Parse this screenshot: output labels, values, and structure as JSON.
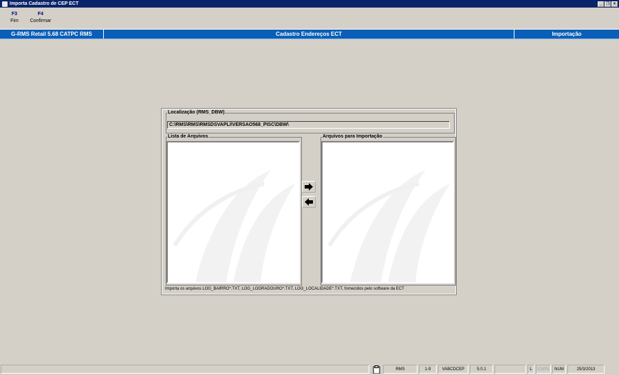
{
  "window": {
    "title": "Importa Cadastro de CEP ECT",
    "controls": [
      "_",
      "❐",
      "×"
    ]
  },
  "toolbar": [
    {
      "key": "F3",
      "label": "Fim"
    },
    {
      "key": "F4",
      "label": "Confirmar"
    }
  ],
  "header": {
    "left": "G-RMS Retail 5.68 CATPC RMS",
    "center": "Cadastro Endereços ECT",
    "right": "Importação"
  },
  "localizacao": {
    "title": "Localização (RMS_DBW)",
    "path": "C:\\RMS\\RMS\\RMSDSVAPLI\\VERSAO568_PISC\\DBW\\"
  },
  "lista_arquivos": {
    "title": "Lista de Arquivos",
    "items": []
  },
  "arquivos_importacao": {
    "title": "Arquivos para Importação",
    "items": []
  },
  "buttons": {
    "add": "arrow-right-icon",
    "remove": "arrow-left-icon"
  },
  "footnote": "Importa os arquivos LOG_BAIRRO*.TXT, LOG_LOGRADOURO*.TXT, LOG_LOCALIDADE*.TXT, fornecidos pelo software da ECT",
  "status": {
    "user": "RMS",
    "company": "1-9",
    "program": "VABCDCEP",
    "version": "5.0.1",
    "lock": "L",
    "caps": "CAPS",
    "num": "NUM",
    "date": "25/3/2013"
  }
}
